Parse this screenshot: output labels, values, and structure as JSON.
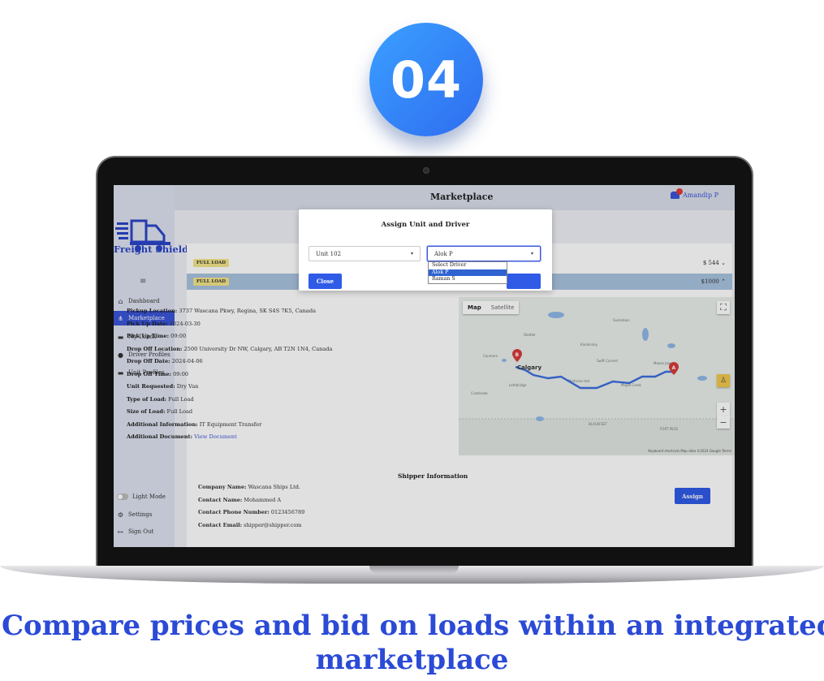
{
  "step_number": "04",
  "app": {
    "title": "Marketplace",
    "logo_text": "Freight Shield",
    "user_name": "Amandip P",
    "notification_count": "10"
  },
  "sidebar": {
    "items": [
      {
        "label": "Dashboard",
        "icon": "home-icon"
      },
      {
        "label": "Marketplace",
        "icon": "marketplace-icon",
        "active": true
      },
      {
        "label": "My Loads",
        "icon": "truck-icon"
      },
      {
        "label": "Driver Profiles",
        "icon": "user-plus-icon"
      },
      {
        "label": "Unit Profiles",
        "icon": "truck-icon"
      }
    ],
    "bottom": [
      {
        "label": "Light Mode",
        "icon": "toggle-icon"
      },
      {
        "label": "Settings",
        "icon": "gear-icon"
      },
      {
        "label": "Sign Out",
        "icon": "sign-out-icon"
      }
    ]
  },
  "loads": [
    {
      "badge": "FULL LOAD",
      "price": "$ 544",
      "chevron": "chevron-down-icon"
    },
    {
      "badge": "FULL LOAD",
      "price": "$1000",
      "chevron": "chevron-up-icon"
    }
  ],
  "details": {
    "pickup_location_label": "Pickup Location:",
    "pickup_location": "3737 Wascana Pkwy, Regina, SK S4S 7K5, Canada",
    "pickup_date_label": "Pick Up Date:",
    "pickup_date": "2024-03-30",
    "pickup_time_label": "Pick Up Time:",
    "pickup_time": "09:00",
    "dropoff_location_label": "Drop Off Location:",
    "dropoff_location": "2500 University Dr NW, Calgary, AB T2N 1N4, Canada",
    "dropoff_date_label": "Drop Off Date:",
    "dropoff_date": "2024-04-06",
    "dropoff_time_label": "Drop Off Time:",
    "dropoff_time": "09:00",
    "unit_requested_label": "Unit Requested:",
    "unit_requested": "Dry Van",
    "type_of_load_label": "Type of Load:",
    "type_of_load": "Full Load",
    "size_of_load_label": "Size of Load:",
    "size_of_load": "Full Load",
    "additional_info_label": "Additional Information:",
    "additional_info": "IT Equipment Transfer",
    "additional_doc_label": "Additional Document:",
    "additional_doc_link": "View Document"
  },
  "map": {
    "map_tab": "Map",
    "satellite_tab": "Satellite",
    "marker_a": "A",
    "marker_b": "B",
    "city_b": "Calgary",
    "footer": "Keyboard shortcuts  Map data ©2024 Google  Terms"
  },
  "shipper": {
    "title": "Shipper Information",
    "company_label": "Company Name:",
    "company": "Wascana Ships Ltd.",
    "contact_label": "Contact Name:",
    "contact": "Mohammed A",
    "phone_label": "Contact Phone Number:",
    "phone": "0123456789",
    "email_label": "Contact Email:",
    "email": "shipper@shipper.com",
    "assign_label": "Assign"
  },
  "modal": {
    "title": "Assign Unit and Driver",
    "unit_value": "Unit 102",
    "driver_value": "Alok P",
    "close_label": "Close",
    "driver_options": [
      "Select Driver",
      "Alok P",
      "Raman S"
    ],
    "selected_option": "Alok P"
  },
  "caption": {
    "line1": "Compare prices and bid on loads within an integrated",
    "line2": "marketplace"
  },
  "colors": {
    "accent": "#2f5be6",
    "caption": "#2b4ad6",
    "badge": "#f3e58a",
    "route": "#3d6ee0",
    "marker": "#d93a3a"
  }
}
